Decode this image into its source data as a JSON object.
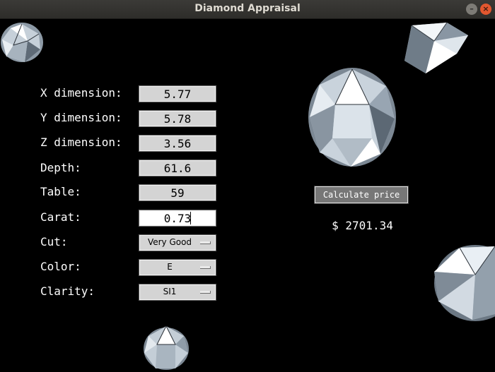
{
  "window": {
    "title": "Diamond Appraisal"
  },
  "form": {
    "fields": [
      {
        "label": "X dimension:",
        "value": "5.77"
      },
      {
        "label": "Y dimension:",
        "value": "5.78"
      },
      {
        "label": "Z dimension:",
        "value": "3.56"
      },
      {
        "label": "Depth:",
        "value": "61.6"
      },
      {
        "label": "Table:",
        "value": "59"
      },
      {
        "label": "Carat:",
        "value": "0.73"
      }
    ],
    "dropdowns": [
      {
        "label": "Cut:",
        "value": "Very Good"
      },
      {
        "label": "Color:",
        "value": "E"
      },
      {
        "label": "Clarity:",
        "value": "SI1"
      }
    ]
  },
  "action": {
    "calculate_label": "Calculate price"
  },
  "result": {
    "price": "$ 2701.34"
  },
  "colors": {
    "background": "#000000",
    "field_bg": "#d4d4d4",
    "button_bg": "#777777",
    "close_button": "#e2572f"
  },
  "icons": {
    "minimize": "minimize-icon",
    "close": "close-icon",
    "decor": "diamond-icon"
  }
}
